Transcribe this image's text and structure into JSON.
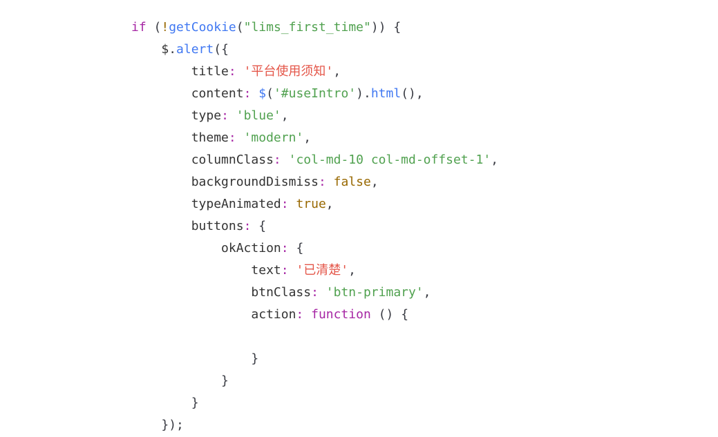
{
  "code": {
    "tokens": {
      "kw_if": "if",
      "bang": "!",
      "fn_getCookie": "getCookie",
      "str_cookie": "\"lims_first_time\"",
      "obj_jquery": "$",
      "fn_alert": "alert",
      "key_title": "title",
      "str_title": "'平台使用须知'",
      "key_content": "content",
      "fn_dollar": "$",
      "str_useIntro": "'#useIntro'",
      "fn_html": "html",
      "key_type": "type",
      "str_blue": "'blue'",
      "key_theme": "theme",
      "str_modern": "'modern'",
      "key_columnClass": "columnClass",
      "str_colClass": "'col-md-10 col-md-offset-1'",
      "key_bgDismiss": "backgroundDismiss",
      "bool_false": "false",
      "key_typeAnimated": "typeAnimated",
      "bool_true": "true",
      "key_buttons": "buttons",
      "key_okAction": "okAction",
      "key_text": "text",
      "str_okText": "'已清楚'",
      "key_btnClass": "btnClass",
      "str_btnPrimary": "'btn-primary'",
      "key_action": "action",
      "kw_function": "function"
    }
  }
}
